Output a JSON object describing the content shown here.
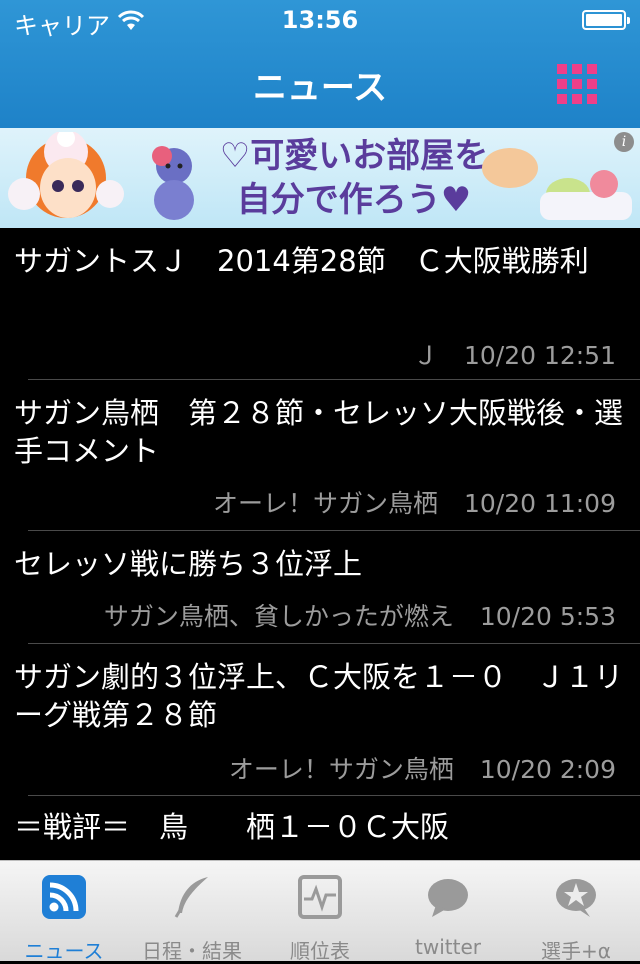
{
  "status_bar": {
    "carrier": "キャリア",
    "time": "13:56"
  },
  "nav": {
    "title": "ニュース",
    "menu_icon": "grid-icon",
    "accent": "#ee3f89",
    "bar_color": "#2384cc"
  },
  "ad": {
    "text": "♡可愛いお部屋を自分で作ろう♥",
    "info": "i"
  },
  "news": [
    {
      "title": "サガントスＪ　2014第28節　Ｃ大阪戦勝利",
      "source": "Ｊ",
      "date": "10/20 12:51"
    },
    {
      "title": "サガン鳥栖　第２８節・セレッソ大阪戦後・選手コメント",
      "source": "オーレ！サガン鳥栖",
      "date": "10/20 11:09"
    },
    {
      "title": "セレッソ戦に勝ち３位浮上",
      "source": "サガン鳥栖、貧しかったが燃え",
      "date": "10/20 5:53"
    },
    {
      "title": "サガン劇的３位浮上、Ｃ大阪を１－０　Ｊ１リーグ戦第２８節",
      "source": "オーレ！サガン鳥栖",
      "date": "10/20 2:09"
    },
    {
      "title": "＝戦評＝　鳥　　栖１－０Ｃ大阪",
      "source": "",
      "date": ""
    }
  ],
  "tabs": [
    {
      "label": "ニュース",
      "icon": "rss-icon",
      "active": true
    },
    {
      "label": "日程・結果",
      "icon": "quill-icon",
      "active": false
    },
    {
      "label": "順位表",
      "icon": "pulse-chart-icon",
      "active": false
    },
    {
      "label": "twitter",
      "icon": "speech-bubble-icon",
      "active": false
    },
    {
      "label": "選手+α",
      "icon": "star-bubble-icon",
      "active": false
    }
  ]
}
